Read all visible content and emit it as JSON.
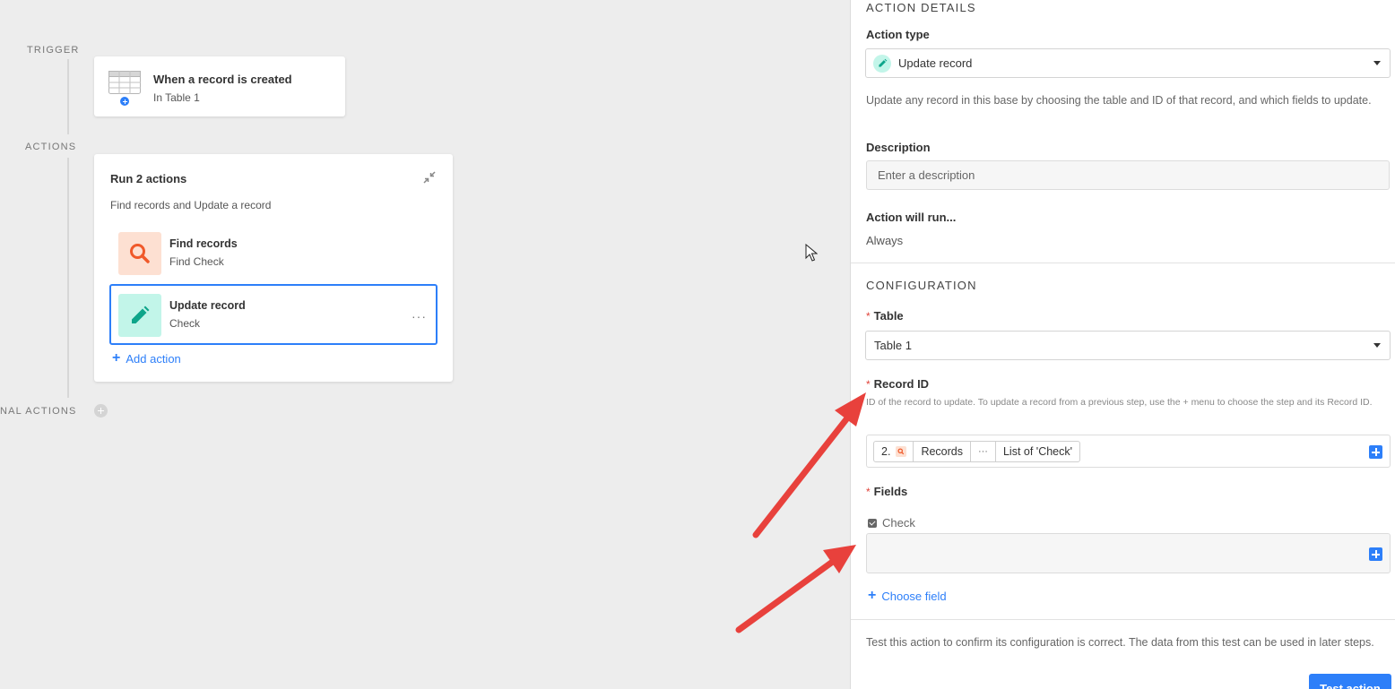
{
  "canvas": {
    "trigger_label": "TRIGGER",
    "actions_label": "ACTIONS",
    "conditional_label": "NAL ACTIONS",
    "trigger_card": {
      "title": "When a record is created",
      "subtitle": "In Table 1"
    },
    "actions_card": {
      "title": "Run 2 actions",
      "subtitle": "Find records and Update a record",
      "items": [
        {
          "title": "Find records",
          "subtitle": "Find Check",
          "icon": "search-icon"
        },
        {
          "title": "Update record",
          "subtitle": "Check",
          "icon": "pencil-icon"
        }
      ],
      "more_label": "···",
      "add_action_label": "Add action"
    }
  },
  "panel": {
    "action_details_header": "ACTION DETAILS",
    "action_type_label": "Action type",
    "action_type_value": "Update record",
    "action_type_help": "Update any record in this base by choosing the table and ID of that record, and which fields to update.",
    "description_label": "Description",
    "description_placeholder": "Enter a description",
    "action_will_run_label": "Action will run...",
    "action_will_run_value": "Always",
    "configuration_header": "CONFIGURATION",
    "table_label": "Table",
    "table_value": "Table 1",
    "record_id_label": "Record ID",
    "record_id_help": "ID of the record to update. To update a record from a previous step, use the + menu to choose the step and its Record ID.",
    "record_id_tokens": [
      "2.",
      "Records",
      "···",
      "List of 'Check'"
    ],
    "fields_label": "Fields",
    "field_check_label": "Check",
    "choose_field_label": "Choose field",
    "test_help": "Test this action to confirm its configuration is correct. The data from this test can be used in later steps.",
    "test_button_label": "Test action"
  },
  "colors": {
    "accent": "#2d7ff9",
    "annotation_arrow": "#e8413c",
    "find_tile": "#fde0d2",
    "update_tile": "#c2f5e9"
  }
}
